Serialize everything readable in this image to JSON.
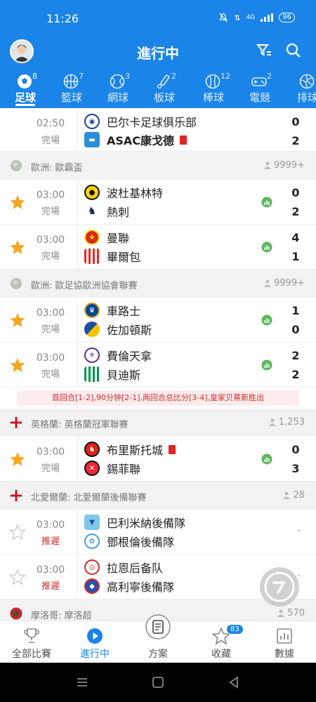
{
  "status": {
    "time": "11:26",
    "battery": "96",
    "signal": "4G"
  },
  "header": {
    "title": "進行中"
  },
  "sports": [
    {
      "label": "足球",
      "count": "8",
      "icon": "soccer-icon"
    },
    {
      "label": "籃球",
      "count": "7",
      "icon": "basketball-icon"
    },
    {
      "label": "網球",
      "count": "3",
      "icon": "tennis-icon"
    },
    {
      "label": "板球",
      "count": "2",
      "icon": "cricket-icon"
    },
    {
      "label": "棒球",
      "count": "12",
      "icon": "baseball-icon"
    },
    {
      "label": "電競",
      "count": "2",
      "icon": "esports-icon"
    },
    {
      "label": "排球",
      "count": "",
      "icon": "volleyball-icon"
    }
  ],
  "leagues": [
    {
      "name": "歐洲: 歐霸盃",
      "viewers": "9999+"
    },
    {
      "name": "歐洲: 歐足協歐洲協會聯賽",
      "viewers": "9999+"
    },
    {
      "name": "英格蘭: 英格蘭冠軍聯賽",
      "viewers": "1,253"
    },
    {
      "name": "北愛爾蘭: 北愛爾蘭後備聯賽",
      "viewers": "28"
    },
    {
      "name": "摩洛哥: 摩洛超",
      "viewers": "570"
    }
  ],
  "matches": [
    {
      "time": "02:50",
      "status": "完場",
      "home": "巴尔卡足球俱乐部",
      "away": "ASAC康戈德",
      "home_score": "0",
      "away_score": "2"
    },
    {
      "time": "03:00",
      "status": "完場",
      "home": "波杜基林特",
      "away": "熱刺",
      "home_score": "0",
      "away_score": "2"
    },
    {
      "time": "03:00",
      "status": "完場",
      "home": "曼聯",
      "away": "畢爾包",
      "home_score": "4",
      "away_score": "1"
    },
    {
      "time": "03:00",
      "status": "完場",
      "home": "車路士",
      "away": "佐加頓斯",
      "home_score": "1",
      "away_score": "0"
    },
    {
      "time": "03:00",
      "status": "完場",
      "home": "費倫天拿",
      "away": "貝迪斯",
      "home_score": "2",
      "away_score": "2"
    },
    {
      "time": "03:00",
      "status": "完場",
      "home": "布里斯托城",
      "away": "錫菲聯",
      "home_score": "0",
      "away_score": "3"
    },
    {
      "time": "03:00",
      "status": "推遲",
      "home": "巴利米納後備隊",
      "away": "鄧根倫後備隊",
      "dash": "-"
    },
    {
      "time": "03:00",
      "status": "推遲",
      "home": "拉恩后备队",
      "away": "高利寧後備隊",
      "dash": "-"
    }
  ],
  "note": "首回合[1-2],90分钟[2-1],两回合总比分[3-4],皇家贝蒂斯胜出",
  "tabbar": [
    {
      "label": "全部比賽"
    },
    {
      "label": "進行中"
    },
    {
      "label": "方案"
    },
    {
      "label": "收藏",
      "badge": "83"
    },
    {
      "label": "數據"
    }
  ],
  "colors": {
    "primary": "#1a84e8",
    "star": "#f5a623",
    "red": "#d62b2b",
    "stat": "#5cb85c"
  }
}
